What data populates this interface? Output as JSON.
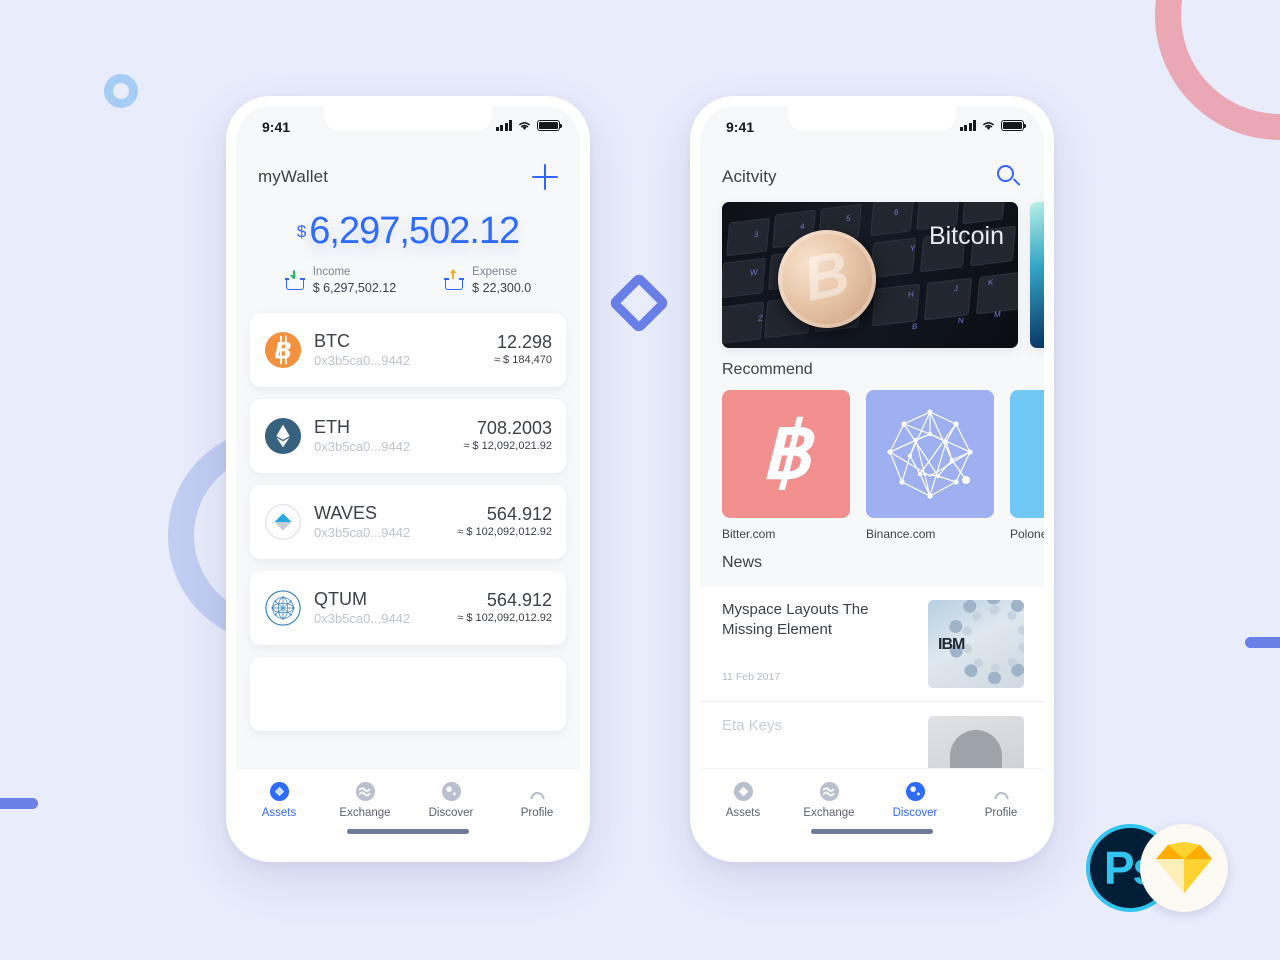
{
  "background": {
    "color": "#e8ecfb",
    "accent": "#3366ff"
  },
  "badges": [
    {
      "name": "photoshop-badge",
      "label": "Ps"
    },
    {
      "name": "sketch-badge",
      "label": ""
    }
  ],
  "phone1": {
    "status": {
      "time": "9:41",
      "signal": "signal-icon",
      "wifi": "wifi-icon",
      "battery": "battery-icon"
    },
    "header": {
      "title": "myWallet",
      "action": "+"
    },
    "balance": {
      "currency": "$",
      "amount": "6,297,502.12"
    },
    "summary": [
      {
        "label": "Income",
        "value": "$ 6,297,502.12",
        "icon": "income-icon"
      },
      {
        "label": "Expense",
        "value": "$ 22,300.0",
        "icon": "expense-icon"
      }
    ],
    "assets": [
      {
        "symbol": "BTC",
        "address": "0x3b5ca0...9442",
        "amount": "12.298",
        "usd": "≈ $ 184,470",
        "icon": "bitcoin-icon"
      },
      {
        "symbol": "ETH",
        "address": "0x3b5ca0...9442",
        "amount": "708.2003",
        "usd": "≈ $ 12,092,021.92",
        "icon": "ethereum-icon"
      },
      {
        "symbol": "WAVES",
        "address": "0x3b5ca0...9442",
        "amount": "564.912",
        "usd": "≈ $ 102,092,012.92",
        "icon": "waves-icon"
      },
      {
        "symbol": "QTUM",
        "address": "0x3b5ca0...9442",
        "amount": "564.912",
        "usd": "≈ $ 102,092,012.92",
        "icon": "qtum-icon"
      }
    ],
    "tabs": [
      {
        "label": "Assets",
        "icon": "assets-icon",
        "active": true
      },
      {
        "label": "Exchange",
        "icon": "exchange-icon",
        "active": false
      },
      {
        "label": "Discover",
        "icon": "discover-icon",
        "active": false
      },
      {
        "label": "Profile",
        "icon": "profile-icon",
        "active": false
      }
    ]
  },
  "phone2": {
    "status": {
      "time": "9:41"
    },
    "header": {
      "title": "Acitvity",
      "action": "search-icon"
    },
    "banners": [
      {
        "caption": "Bitcoin",
        "name": "bitcoin-keyboard-banner"
      },
      {
        "caption": "",
        "name": "teal-banner"
      }
    ],
    "recommend": {
      "title": "Recommend",
      "items": [
        {
          "name": "Bitter.com",
          "color": "#f2908f",
          "logo": "bitcoin-logo"
        },
        {
          "name": "Binance.com",
          "color": "#9eb0ef",
          "logo": "network-logo"
        },
        {
          "name": "Polone",
          "color": "#72c8f5",
          "logo": "poloniex-logo"
        }
      ]
    },
    "news": {
      "title": "News",
      "items": [
        {
          "title": "Myspace Layouts The Missing Element",
          "date": "11 Feb 2017",
          "thumb": "ibm-thumb"
        },
        {
          "title": "Eta Keys",
          "date": "",
          "thumb": "person-thumb"
        }
      ]
    },
    "tabs": [
      {
        "label": "Assets",
        "icon": "assets-icon",
        "active": false
      },
      {
        "label": "Exchange",
        "icon": "exchange-icon",
        "active": false
      },
      {
        "label": "Discover",
        "icon": "discover-icon",
        "active": true
      },
      {
        "label": "Profile",
        "icon": "profile-icon",
        "active": false
      }
    ]
  }
}
